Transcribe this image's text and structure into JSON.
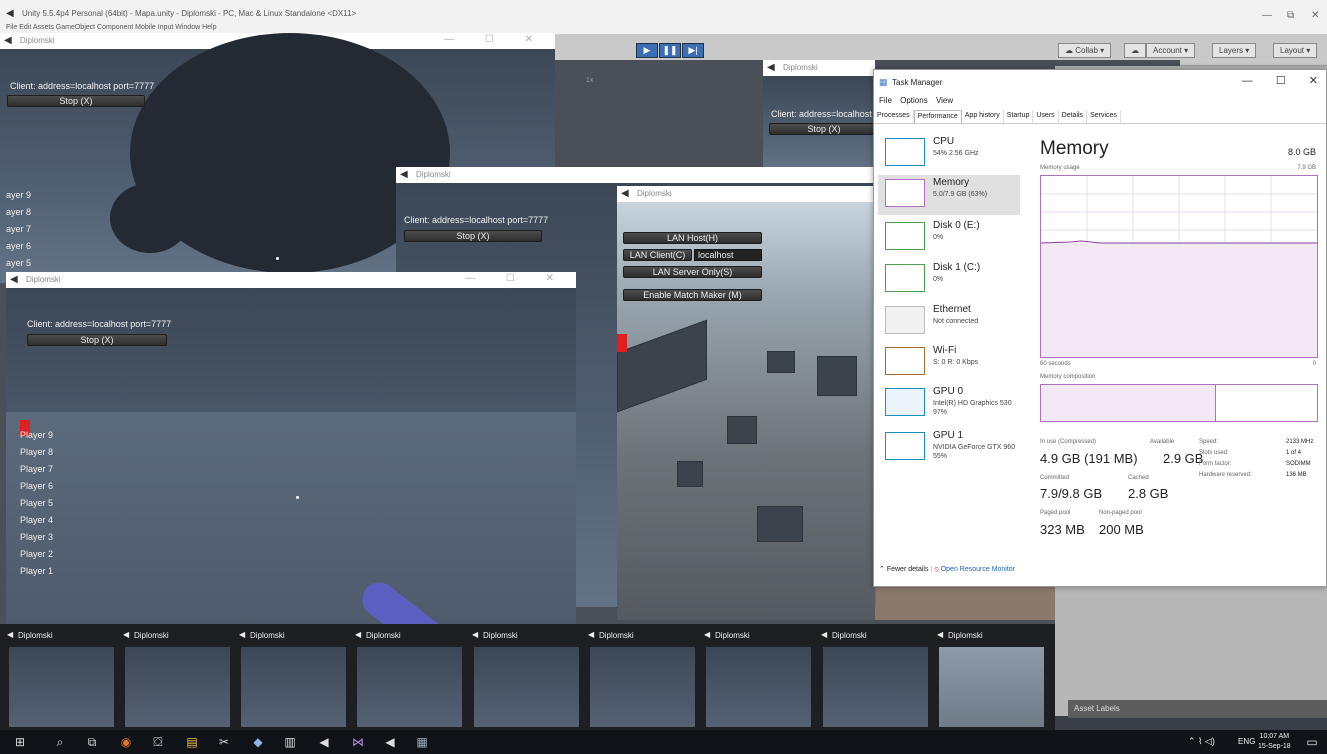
{
  "unity": {
    "title": "Unity 5.5.4p4 Personal (64bit) - Mapa.unity - Diplomski - PC, Mac & Linux Standalone <DX11>",
    "menu": "File  Edit  Assets  GameObject  Component  Mobile Input  Window  Help",
    "collab": "Collab",
    "account": "Account",
    "layers": "Layers",
    "layout": "Layout",
    "asset_labels": "Asset Labels",
    "scale": "1x"
  },
  "game": {
    "window_title": "Diplomski",
    "client_text": "Client: address=localhost port=7777",
    "client_text_cut": "Client: address=localhost",
    "stop_btn": "Stop (X)",
    "lan_host": "LAN Host(H)",
    "lan_client": "LAN Client(C)",
    "lan_client_field": "localhost",
    "lan_server": "LAN Server Only(S)",
    "match_maker": "Enable Match Maker (M)",
    "players": [
      "Player 9",
      "Player 8",
      "Player 7",
      "Player 6",
      "Player 5",
      "Player 4",
      "Player 3",
      "Player 2",
      "Player 1"
    ],
    "players_cut": [
      "ayer 9",
      "ayer 8",
      "ayer 7",
      "ayer 6",
      "ayer 5"
    ]
  },
  "taskmgr": {
    "title": "Task Manager",
    "menu": [
      "File",
      "Options",
      "View"
    ],
    "tabs": [
      "Processes",
      "Performance",
      "App history",
      "Startup",
      "Users",
      "Details",
      "Services"
    ],
    "resources": [
      {
        "name": "CPU",
        "sub": "54% 2.56 GHz"
      },
      {
        "name": "Memory",
        "sub": "5.0/7.9 GB (63%)"
      },
      {
        "name": "Disk 0 (E:)",
        "sub": "0%"
      },
      {
        "name": "Disk 1 (C:)",
        "sub": "0%"
      },
      {
        "name": "Ethernet",
        "sub": "Not connected"
      },
      {
        "name": "Wi-Fi",
        "sub": "S: 0 R: 0 Kbps"
      },
      {
        "name": "GPU 0",
        "sub": "Intel(R) HD Graphics 530 97%"
      },
      {
        "name": "GPU 1",
        "sub": "NVIDIA GeForce GTX 960 55%"
      }
    ],
    "memory_title": "Memory",
    "memory_total": "8.0 GB",
    "memory_usage_label": "Memory usage",
    "memory_usage_max": "7.9 GB",
    "graph_left": "60 seconds",
    "graph_right": "0",
    "composition_label": "Memory composition",
    "in_use_label": "In use (Compressed)",
    "in_use_value": "4.9 GB (191 MB)",
    "available_label": "Available",
    "available_value": "2.9 GB",
    "committed_label": "Committed",
    "committed_value": "7.9/9.8 GB",
    "cached_label": "Cached",
    "cached_value": "2.8 GB",
    "paged_label": "Paged pool",
    "paged_value": "323 MB",
    "nonpaged_label": "Non-paged pool",
    "nonpaged_value": "200 MB",
    "speed_label": "Speed:",
    "speed_value": "2133 MHz",
    "slots_label": "Slots used:",
    "slots_value": "1 of 4",
    "form_label": "Form factor:",
    "form_value": "SODIMM",
    "hwres_label": "Hardware reserved:",
    "hwres_value": "136 MB",
    "fewer_details": "Fewer details",
    "open_monitor": "Open Resource Monitor"
  },
  "thumbs": [
    "Diplomski",
    "Diplomski",
    "Diplomski",
    "Diplomski",
    "Diplomski",
    "Diplomski",
    "Diplomski",
    "Diplomski",
    "Diplomski"
  ],
  "tray": {
    "lang": "ENG",
    "time": "10:07 AM",
    "date": "15-Sep-18"
  },
  "colors": {
    "unity_play": "#3b6eb5",
    "memory_accent": "#b06fbf",
    "cpu_accent": "#1b8fc4",
    "disk_accent": "#4ca14a",
    "wifi_accent": "#a86f24"
  }
}
